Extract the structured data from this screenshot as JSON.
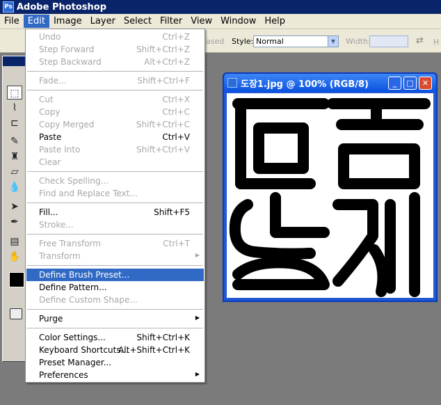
{
  "app": {
    "title": "Adobe Photoshop"
  },
  "menubar": {
    "items": [
      "File",
      "Edit",
      "Image",
      "Layer",
      "Select",
      "Filter",
      "View",
      "Window",
      "Help"
    ],
    "active": "Edit"
  },
  "options": {
    "feather_frag": "ased",
    "style_label": "Style:",
    "style_value": "Normal",
    "width_label": "Width:",
    "height_label": "H"
  },
  "document": {
    "title": "도장1.jpg @ 100% (RGB/8)"
  },
  "edit_menu": {
    "items": [
      {
        "label": "Undo",
        "shortcut": "Ctrl+Z",
        "enabled": false
      },
      {
        "label": "Step Forward",
        "shortcut": "Shift+Ctrl+Z",
        "enabled": false
      },
      {
        "label": "Step Backward",
        "shortcut": "Alt+Ctrl+Z",
        "enabled": false
      },
      {
        "label": "Fade...",
        "shortcut": "Shift+Ctrl+F",
        "enabled": false
      },
      {
        "label": "Cut",
        "shortcut": "Ctrl+X",
        "enabled": false
      },
      {
        "label": "Copy",
        "shortcut": "Ctrl+C",
        "enabled": false
      },
      {
        "label": "Copy Merged",
        "shortcut": "Shift+Ctrl+C",
        "enabled": false
      },
      {
        "label": "Paste",
        "shortcut": "Ctrl+V",
        "enabled": true
      },
      {
        "label": "Paste Into",
        "shortcut": "Shift+Ctrl+V",
        "enabled": false
      },
      {
        "label": "Clear",
        "shortcut": "",
        "enabled": false
      },
      {
        "label": "Check Spelling...",
        "shortcut": "",
        "enabled": false
      },
      {
        "label": "Find and Replace Text...",
        "shortcut": "",
        "enabled": false
      },
      {
        "label": "Fill...",
        "shortcut": "Shift+F5",
        "enabled": true
      },
      {
        "label": "Stroke...",
        "shortcut": "",
        "enabled": false
      },
      {
        "label": "Free Transform",
        "shortcut": "Ctrl+T",
        "enabled": false
      },
      {
        "label": "Transform",
        "shortcut": "",
        "enabled": false
      },
      {
        "label": "Define Brush Preset...",
        "shortcut": "",
        "enabled": true
      },
      {
        "label": "Define Pattern...",
        "shortcut": "",
        "enabled": true
      },
      {
        "label": "Define Custom Shape...",
        "shortcut": "",
        "enabled": false
      },
      {
        "label": "Purge",
        "shortcut": "",
        "enabled": true
      },
      {
        "label": "Color Settings...",
        "shortcut": "Shift+Ctrl+K",
        "enabled": true
      },
      {
        "label": "Keyboard Shortcuts...",
        "shortcut": "Alt+Shift+Ctrl+K",
        "enabled": true
      },
      {
        "label": "Preset Manager...",
        "shortcut": "",
        "enabled": true
      },
      {
        "label": "Preferences",
        "shortcut": "",
        "enabled": true
      }
    ],
    "highlighted": "Define Brush Preset..."
  },
  "icons": {
    "toolbox": [
      "marquee-icon",
      "lasso-icon",
      "crop-icon",
      "healing-brush-icon",
      "stamp-icon",
      "eraser-icon",
      "blur-icon",
      "path-selection-icon",
      "pen-icon",
      "notes-icon",
      "hand-icon"
    ],
    "submenu_arrow": "triangle-right-icon"
  },
  "colors": {
    "title_bar": "#0a246a",
    "menu_highlight": "#316ac5",
    "foreground": "#000000"
  }
}
